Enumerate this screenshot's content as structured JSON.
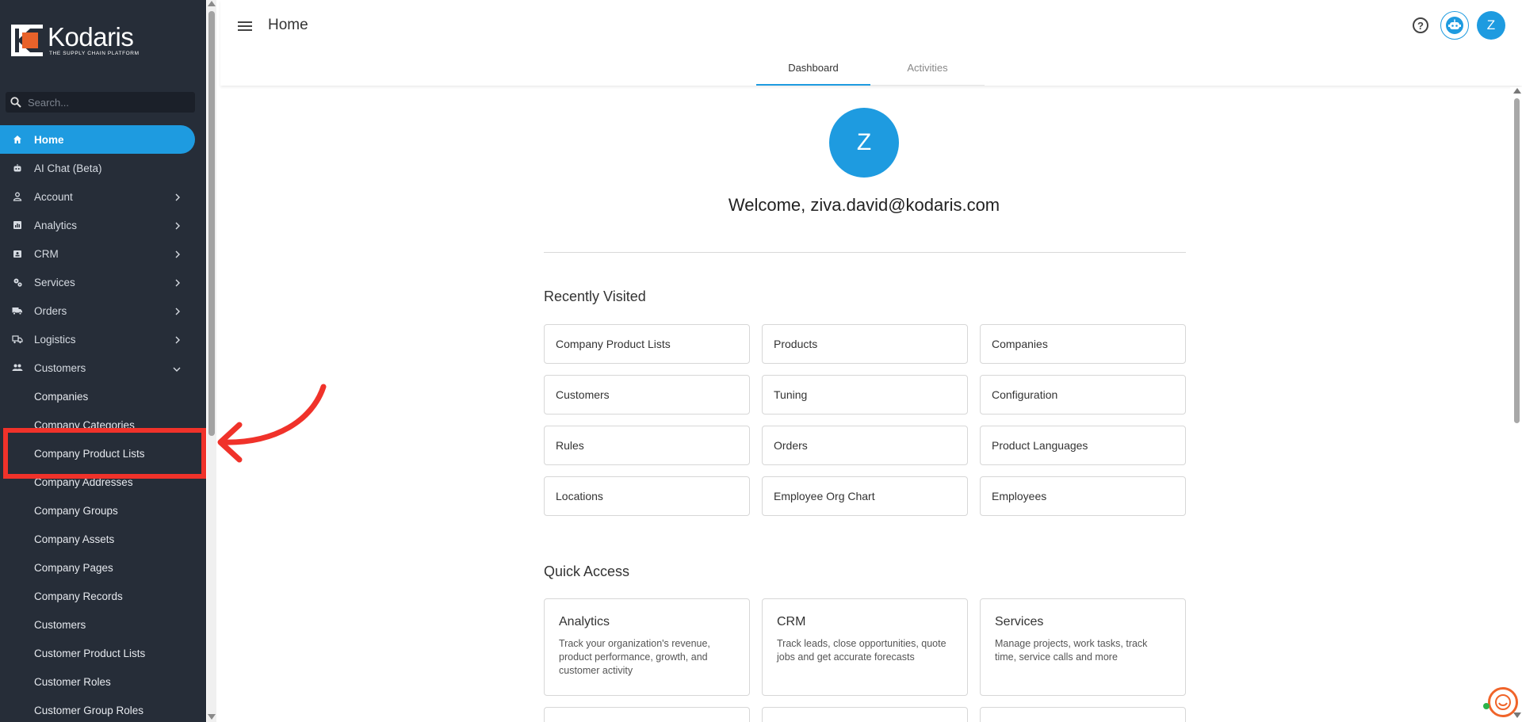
{
  "app": {
    "logo_name": "Kodaris",
    "logo_tagline": "THE SUPPLY CHAIN PLATFORM"
  },
  "sidebar": {
    "search_placeholder": "Search...",
    "items": [
      {
        "label": "Home",
        "icon": "home-icon",
        "active": true,
        "expandable": false
      },
      {
        "label": "AI Chat (Beta)",
        "icon": "robot-icon",
        "expandable": false
      },
      {
        "label": "Account",
        "icon": "person-icon",
        "expandable": true
      },
      {
        "label": "Analytics",
        "icon": "analytics-icon",
        "expandable": true
      },
      {
        "label": "CRM",
        "icon": "contact-card-icon",
        "expandable": true
      },
      {
        "label": "Services",
        "icon": "gears-icon",
        "expandable": true
      },
      {
        "label": "Orders",
        "icon": "truck-icon",
        "expandable": true
      },
      {
        "label": "Logistics",
        "icon": "delivery-icon",
        "expandable": true
      },
      {
        "label": "Customers",
        "icon": "people-icon",
        "expandable": true,
        "expanded": true
      }
    ],
    "sub_items": [
      "Companies",
      "Company Categories",
      "Company Product Lists",
      "Company Addresses",
      "Company Groups",
      "Company Assets",
      "Company Pages",
      "Company Records",
      "Customers",
      "Customer Product Lists",
      "Customer Roles",
      "Customer Group Roles"
    ]
  },
  "header": {
    "title": "Home",
    "avatar_initial": "Z",
    "help_glyph": "?"
  },
  "tabs": [
    {
      "label": "Dashboard",
      "active": true
    },
    {
      "label": "Activities",
      "active": false
    }
  ],
  "main": {
    "avatar_initial": "Z",
    "welcome": "Welcome, ziva.david@kodaris.com",
    "recently_visited_title": "Recently Visited",
    "recently_visited": [
      "Company Product Lists",
      "Products",
      "Companies",
      "Customers",
      "Tuning",
      "Configuration",
      "Rules",
      "Orders",
      "Product Languages",
      "Locations",
      "Employee Org Chart",
      "Employees"
    ],
    "quick_access_title": "Quick Access",
    "quick_access": [
      {
        "title": "Analytics",
        "desc": "Track your organization's revenue, product performance, growth, and customer activity"
      },
      {
        "title": "CRM",
        "desc": "Track leads, close opportunities, quote jobs and get accurate forecasts"
      },
      {
        "title": "Services",
        "desc": "Manage projects, work tasks, track time, service calls and more"
      }
    ]
  },
  "colors": {
    "accent": "#1e9be0",
    "sidebar_bg": "#262d38",
    "annotation": "#f0322a"
  }
}
